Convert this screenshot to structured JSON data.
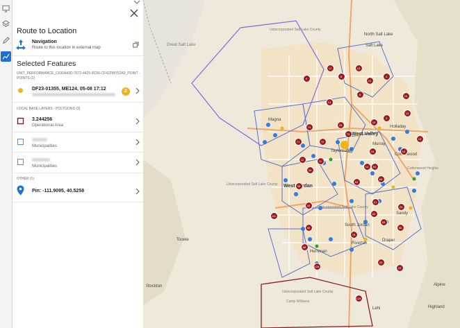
{
  "rail": {
    "icons": [
      "monitor-icon",
      "layers-icon",
      "pencil-icon",
      "analytics-icon"
    ]
  },
  "panel": {
    "route_title": "Route to Location",
    "navigation_title": "Navigation",
    "navigation_subtitle": "Route to this location in external map",
    "selected_title": "Selected Features",
    "group_unit": "UNIT_PERFORMANCE_C630A43D-7672-4425-8C56-CF42298752A3_POINT - POINTS (1)",
    "unit_feature_title": "DF23-01355, ME124, 05-08 17:12",
    "unit_feature_badge": "2",
    "group_local": "LOCAL BASE LAYERS - POLYGONS (3)",
    "poly1_title": "3.244256",
    "poly1_sub": "Operational Area",
    "poly2_sub": "Municipalities",
    "poly3_sub": "Municipalities",
    "group_other": "OTHER (1)",
    "pin_title": "Pin: -111.9095, 40.5258"
  },
  "map": {
    "labels": {
      "north_salt_lake": "North Salt Lake",
      "unincorporated_1": "Unincorporated Salt Lake County",
      "great_salt_lake": "Great Salt Lake",
      "unincorporated_2": "Unincorporated Salt Lake County",
      "unincorporated_3": "Unincorporated Salt Lake County",
      "unincorporated_4": "Unincorporated Salt Lake County",
      "camp_williams": "Camp Williams",
      "west_valley": "West Valley",
      "west_jordan": "West Jordan",
      "south_jordan": "South Jordan",
      "riverton": "Riverton",
      "draper": "Draper",
      "holladay": "Holladay",
      "cottonwood": "Cottonwood",
      "sandy": "Sandy",
      "magna": "Magna",
      "tooele": "Tooele",
      "stockton": "Stockton",
      "alpine": "Alpine",
      "lehi": "Lehi",
      "murray": "Murray",
      "taylorsville": "Taylorsville",
      "herriman": "Herriman",
      "salt_lake": "Salt Lake",
      "cottonwood_heights": "Cottonwood Heights",
      "highland": "Highland"
    },
    "markers": [
      "12",
      "13",
      "9",
      "8",
      "4",
      "10",
      "15",
      "8",
      "14",
      "3",
      "13",
      "74",
      "25",
      "73",
      "71",
      "72",
      "19",
      "15",
      "10",
      "15",
      "12",
      "11",
      "14",
      "64",
      "30",
      "95",
      "34",
      "111",
      "24",
      "69",
      "53",
      "21",
      "62",
      "56",
      "55",
      "56",
      "78",
      "88",
      "128",
      "23",
      "129",
      "22"
    ],
    "colors": {
      "marker": "#9e1b1b",
      "dot_blue": "#2f7de1",
      "dot_yellow": "#f2b21c",
      "boundary": "#3b5fcf",
      "interstate": "#f0a66a",
      "operational_area": "#8a1b1b"
    }
  }
}
